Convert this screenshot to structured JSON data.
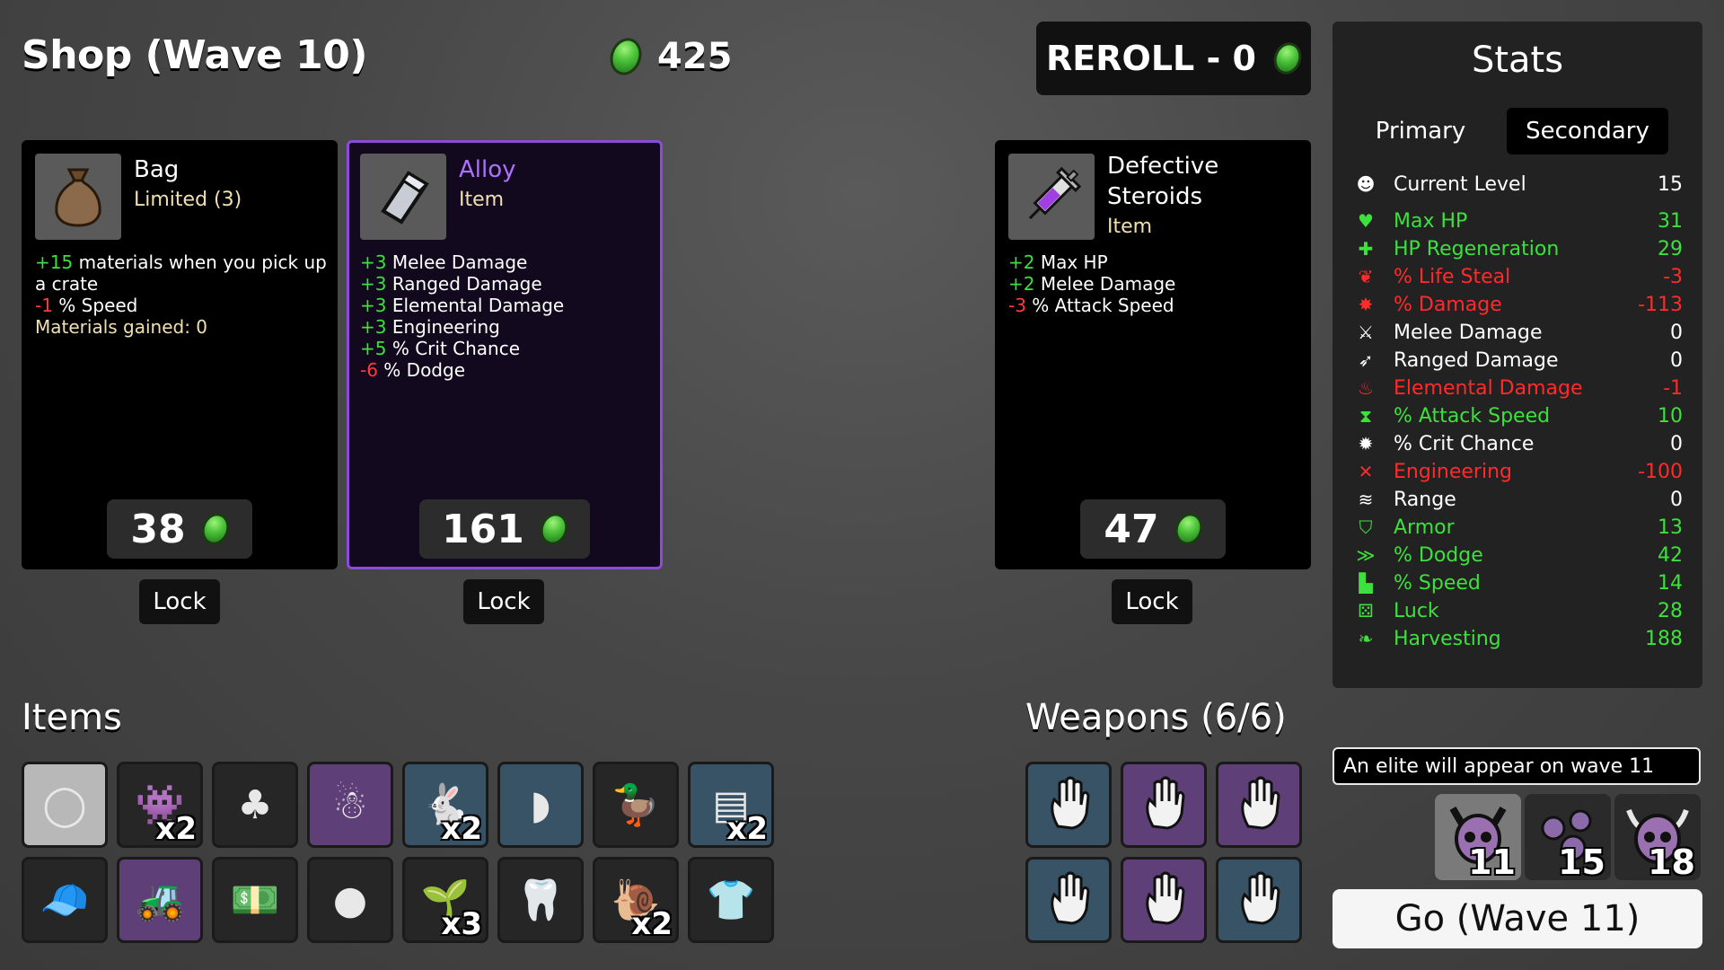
{
  "shop": {
    "title": "Shop (Wave 10)",
    "materials": "425",
    "reroll_label": "REROLL - 0"
  },
  "cards": [
    {
      "name": "Bag",
      "subtitle": "Limited (3)",
      "lines": [
        {
          "prefix": "+15",
          "text": " materials when you pick up a crate",
          "sign": "pos"
        },
        {
          "prefix": "-1",
          "text": " % Speed",
          "sign": "neg"
        },
        {
          "prefix": "",
          "text": "Materials gained: 0",
          "sign": "yel"
        }
      ],
      "price": "38",
      "lock_label": "Lock",
      "icon": "bag-icon"
    },
    {
      "name": "Alloy",
      "subtitle": "Item",
      "lines": [
        {
          "prefix": "+3",
          "text": " Melee Damage",
          "sign": "pos"
        },
        {
          "prefix": "+3",
          "text": " Ranged Damage",
          "sign": "pos"
        },
        {
          "prefix": "+3",
          "text": " Elemental Damage",
          "sign": "pos"
        },
        {
          "prefix": "+3",
          "text": " Engineering",
          "sign": "pos"
        },
        {
          "prefix": "+5",
          "text": " % Crit Chance",
          "sign": "pos"
        },
        {
          "prefix": "-6",
          "text": " % Dodge",
          "sign": "neg"
        }
      ],
      "price": "161",
      "lock_label": "Lock",
      "icon": "alloy-icon"
    },
    {
      "name": "Defective Steroids",
      "subtitle": "Item",
      "lines": [
        {
          "prefix": "+2",
          "text": " Max HP",
          "sign": "pos"
        },
        {
          "prefix": "+2",
          "text": " Melee Damage",
          "sign": "pos"
        },
        {
          "prefix": "-3",
          "text": " % Attack Speed",
          "sign": "neg"
        }
      ],
      "price": "47",
      "lock_label": "Lock",
      "icon": "syringe-icon"
    }
  ],
  "stats": {
    "title": "Stats",
    "tabs": [
      "Primary",
      "Secondary"
    ],
    "active_tab": "Secondary",
    "rows": [
      {
        "label": "Current Level",
        "value": "15",
        "color": "#ffffff",
        "icon": "level-icon"
      },
      {
        "label": "Max HP",
        "value": "31",
        "color": "#3ce13c",
        "icon": "heart-icon"
      },
      {
        "label": "HP Regeneration",
        "value": "29",
        "color": "#3ce13c",
        "icon": "regen-icon"
      },
      {
        "label": "% Life Steal",
        "value": "-3",
        "color": "#ff2a2a",
        "icon": "lifesteal-icon"
      },
      {
        "label": "% Damage",
        "value": "-113",
        "color": "#ff2a2a",
        "icon": "damage-icon"
      },
      {
        "label": "Melee Damage",
        "value": "0",
        "color": "#ffffff",
        "icon": "sword-icon"
      },
      {
        "label": "Ranged Damage",
        "value": "0",
        "color": "#ffffff",
        "icon": "bow-icon"
      },
      {
        "label": "Elemental Damage",
        "value": "-1",
        "color": "#ff2a2a",
        "icon": "flame-icon"
      },
      {
        "label": "% Attack Speed",
        "value": "10",
        "color": "#3ce13c",
        "icon": "hourglass-icon"
      },
      {
        "label": "% Crit Chance",
        "value": "0",
        "color": "#ffffff",
        "icon": "crit-icon"
      },
      {
        "label": "Engineering",
        "value": "-100",
        "color": "#ff2a2a",
        "icon": "wrench-icon"
      },
      {
        "label": "Range",
        "value": "0",
        "color": "#ffffff",
        "icon": "range-icon"
      },
      {
        "label": "Armor",
        "value": "13",
        "color": "#3ce13c",
        "icon": "shield-icon"
      },
      {
        "label": "% Dodge",
        "value": "42",
        "color": "#3ce13c",
        "icon": "dodge-icon"
      },
      {
        "label": "% Speed",
        "value": "14",
        "color": "#3ce13c",
        "icon": "boot-icon"
      },
      {
        "label": "Luck",
        "value": "28",
        "color": "#3ce13c",
        "icon": "dice-icon"
      },
      {
        "label": "Harvesting",
        "value": "188",
        "color": "#3ce13c",
        "icon": "wheat-icon"
      }
    ]
  },
  "items": {
    "title": "Items",
    "slots": [
      {
        "icon": "egg-icon",
        "qty": "",
        "tier": "gray"
      },
      {
        "icon": "alien-icon",
        "qty": "x2",
        "tier": "dark"
      },
      {
        "icon": "mushroom-icon",
        "qty": "",
        "tier": "dark"
      },
      {
        "icon": "scarecrow-icon",
        "qty": "",
        "tier": "purple"
      },
      {
        "icon": "rabbit-icon",
        "qty": "x2",
        "tier": "blue"
      },
      {
        "icon": "helmet-icon",
        "qty": "",
        "tier": "blue"
      },
      {
        "icon": "duck-icon",
        "qty": "",
        "tier": "dark"
      },
      {
        "icon": "cape-icon",
        "qty": "x2",
        "tier": "blue"
      },
      {
        "icon": "propeller-hat-icon",
        "qty": "",
        "tier": "dark"
      },
      {
        "icon": "tractor-icon",
        "qty": "",
        "tier": "purple"
      },
      {
        "icon": "cash-icon",
        "qty": "",
        "tier": "dark"
      },
      {
        "icon": "bag-icon",
        "qty": "",
        "tier": "dark"
      },
      {
        "icon": "sprout-icon",
        "qty": "x3",
        "tier": "dark"
      },
      {
        "icon": "tooth-icon",
        "qty": "",
        "tier": "dark"
      },
      {
        "icon": "snail-icon",
        "qty": "x2",
        "tier": "dark"
      },
      {
        "icon": "flannel-shirt-icon",
        "qty": "",
        "tier": "dark"
      }
    ]
  },
  "weapons": {
    "title": "Weapons (6/6)",
    "slots": [
      {
        "icon": "hand-icon",
        "tier": "blue"
      },
      {
        "icon": "hand-icon",
        "tier": "purple"
      },
      {
        "icon": "hand-icon",
        "tier": "purple"
      },
      {
        "icon": "hand-icon",
        "tier": "blue"
      },
      {
        "icon": "hand-icon",
        "tier": "purple"
      },
      {
        "icon": "hand-icon",
        "tier": "blue"
      }
    ]
  },
  "wave_info": {
    "notice": "An elite will appear on wave 11",
    "enemies": [
      {
        "wave": "11",
        "icon": "elite-skull-icon"
      },
      {
        "wave": "15",
        "icon": "bug-swarm-icon"
      },
      {
        "wave": "18",
        "icon": "horned-skull-icon"
      }
    ],
    "go_label": "Go (Wave 11)"
  },
  "colors": {
    "positive": "#3ce13c",
    "negative": "#ff3a3a",
    "rare_border": "#8b4cd8"
  }
}
